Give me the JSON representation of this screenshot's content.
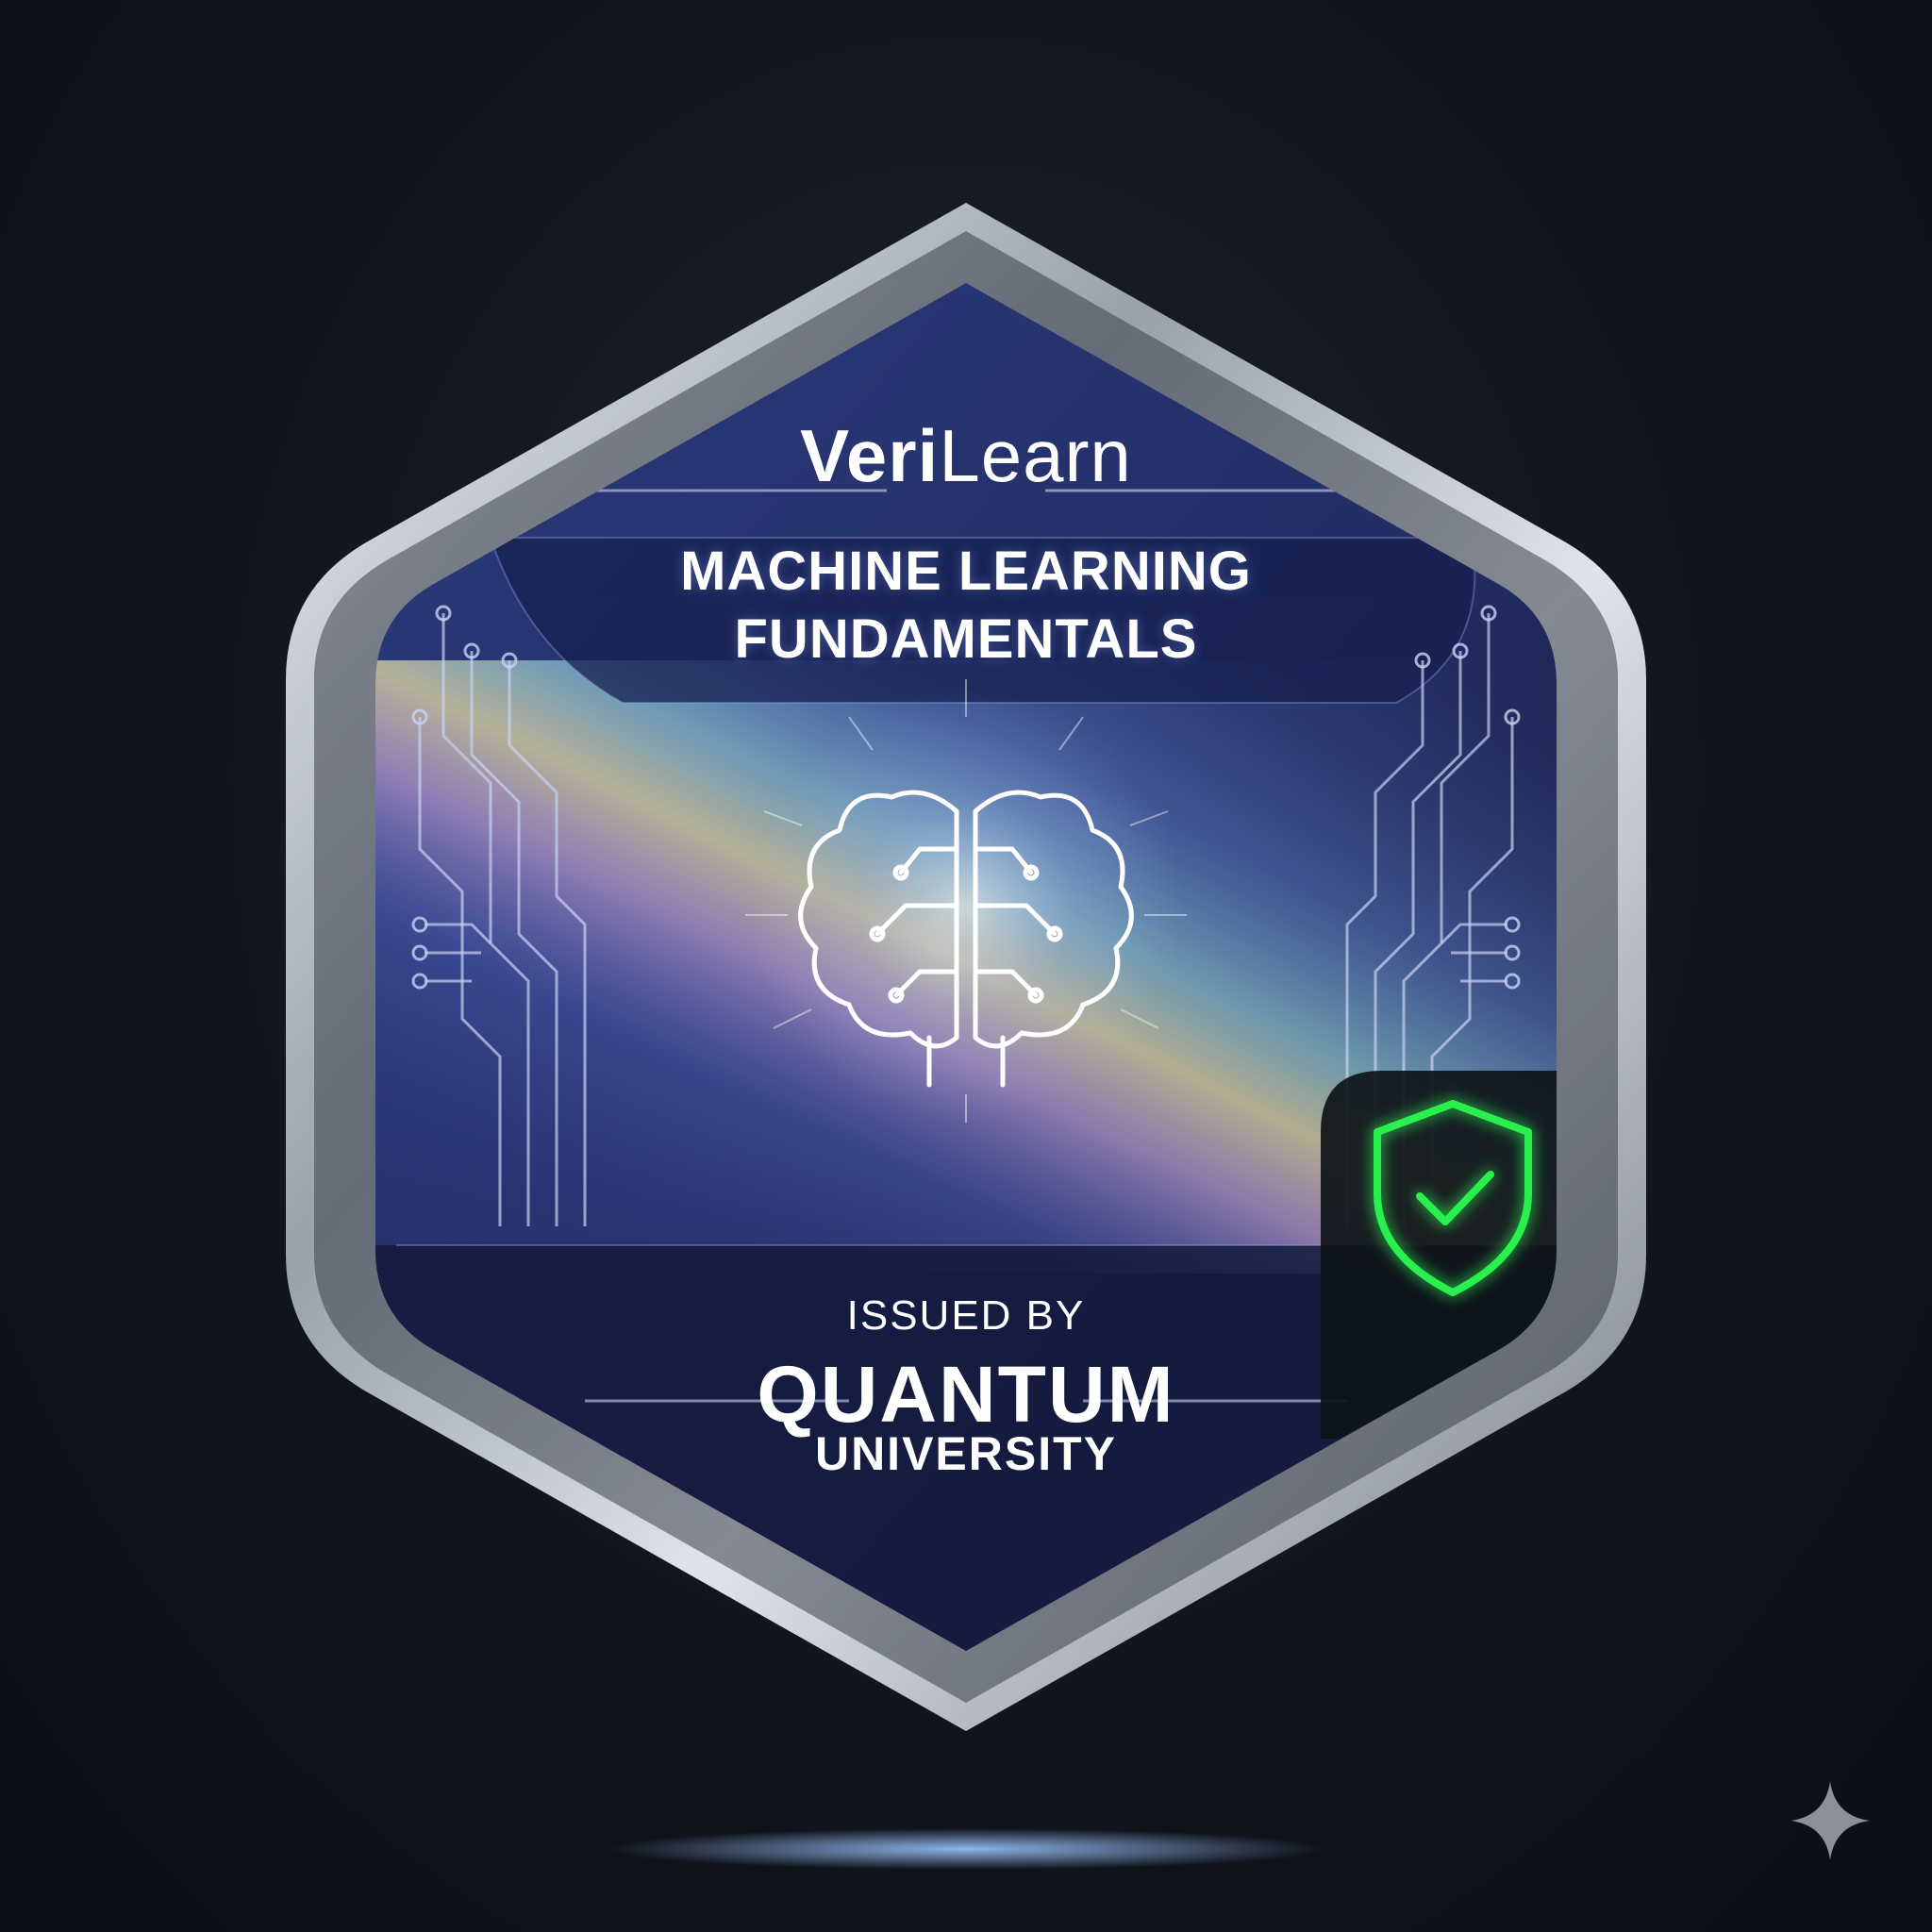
{
  "badge": {
    "brand": {
      "bold_part": "Veri",
      "light_part": "Learn"
    },
    "course_title": {
      "line1": "MACHINE LEARNING",
      "line2": "FUNDAMENTALS"
    },
    "issued_label": "ISSUED BY",
    "issuer": {
      "name": "QUANTUM",
      "sub": "UNIVERSITY"
    },
    "icons": {
      "center": "brain-circuit-icon",
      "verified": "shield-check-icon",
      "corner": "sparkle-icon"
    },
    "colors": {
      "background": "#11151d",
      "frame": "#c9ced6",
      "panel": "#1e2a5e",
      "verified_green": "#22e04a",
      "text": "#ffffff"
    }
  }
}
